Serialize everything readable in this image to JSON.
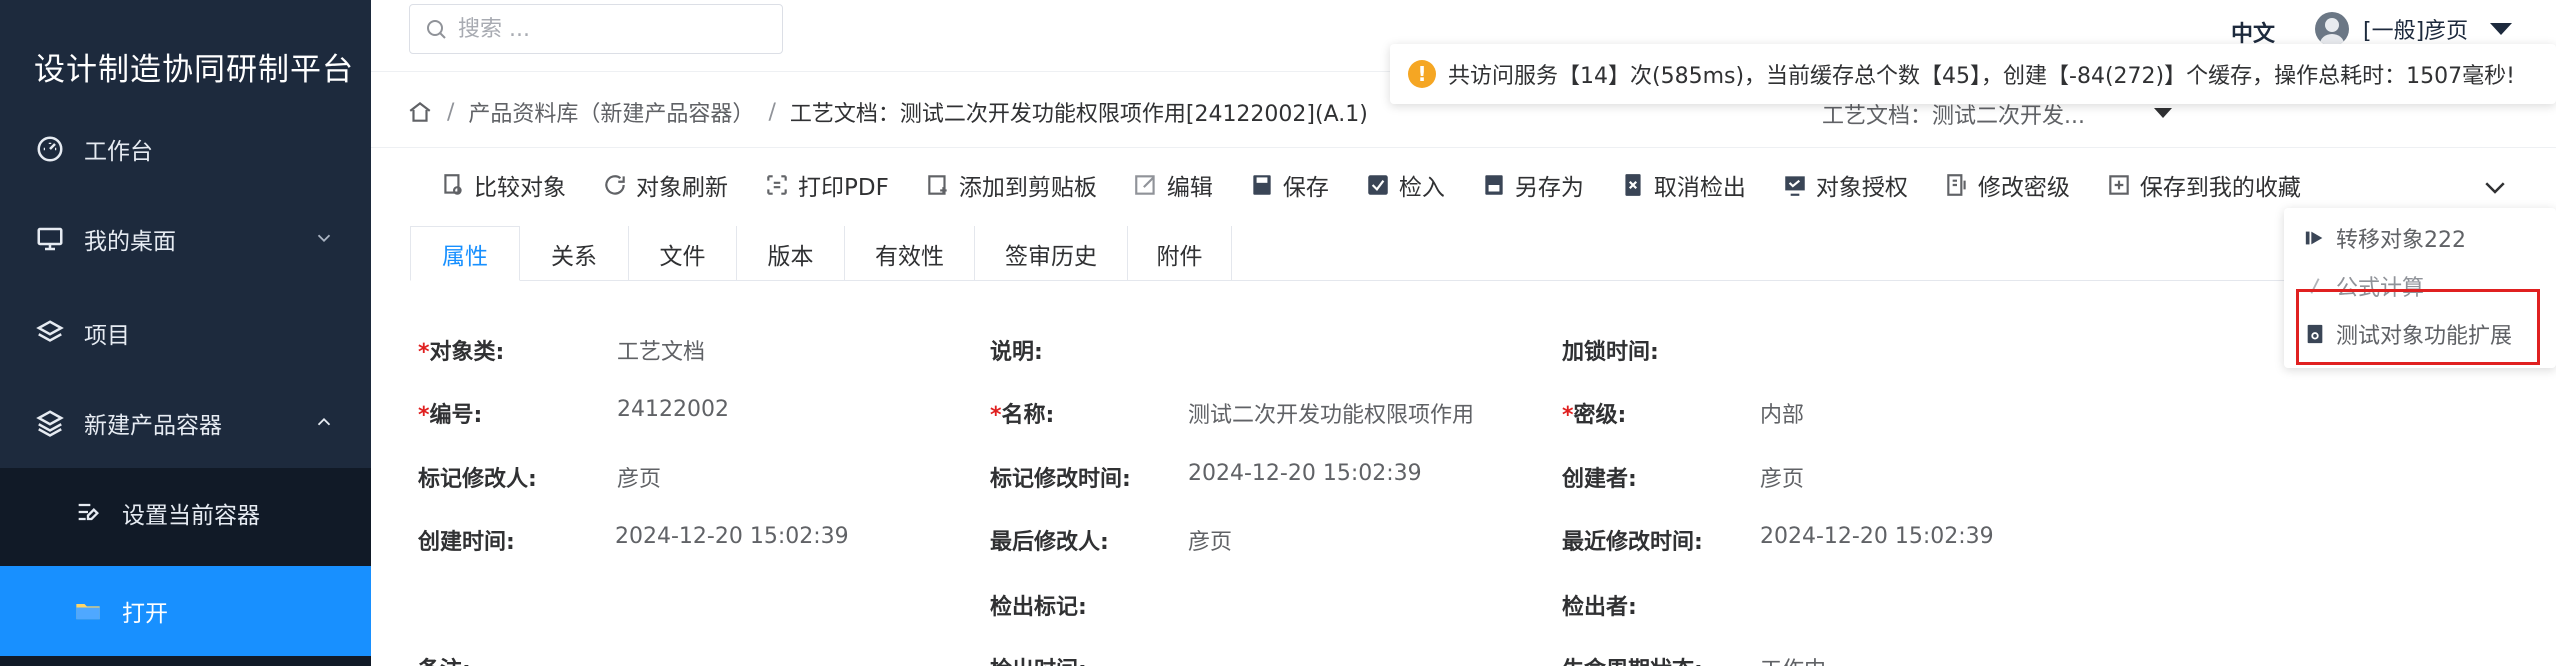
{
  "sidebar": {
    "brand": "设计制造协同研制平台",
    "items": [
      {
        "label": "工作台",
        "icon": "dashboard-icon"
      },
      {
        "label": "我的桌面",
        "icon": "monitor-icon"
      },
      {
        "label": "项目",
        "icon": "layers-icon"
      },
      {
        "label": "新建产品容器",
        "icon": "layers-icon"
      }
    ],
    "sub_items": [
      {
        "label": "设置当前容器",
        "icon": "list-settings-icon"
      },
      {
        "label": "打开",
        "icon": "folder-icon",
        "active": true
      }
    ],
    "bg_color": "#1d2a3d",
    "active_color": "#1890ff"
  },
  "header": {
    "search_placeholder": "搜索 ...",
    "language": "中文",
    "user": "[一般]彦页"
  },
  "notice": {
    "text": "共访问服务【14】次(585ms)，当前缓存总个数【45】，创建【-84(272)】个缓存，操作总耗时：1507毫秒!"
  },
  "breadcrumb": {
    "items": [
      "产品资料库（新建产品容器）",
      "工艺文档：测试二次开发功能权限项作用[24122002](A.1)"
    ],
    "select_value": "工艺文档：测试二次开发..."
  },
  "toolbar": {
    "buttons": [
      {
        "label": "比较对象",
        "icon": "compare-icon"
      },
      {
        "label": "对象刷新",
        "icon": "refresh-icon"
      },
      {
        "label": "打印PDF",
        "icon": "print-pdf-icon"
      },
      {
        "label": "添加到剪贴板",
        "icon": "clipboard-add-icon"
      },
      {
        "label": "编辑",
        "icon": "edit-icon"
      },
      {
        "label": "保存",
        "icon": "save-icon"
      },
      {
        "label": "检入",
        "icon": "checkin-icon"
      },
      {
        "label": "另存为",
        "icon": "save-as-icon"
      },
      {
        "label": "取消检出",
        "icon": "cancel-checkout-icon"
      },
      {
        "label": "对象授权",
        "icon": "authorize-icon"
      },
      {
        "label": "修改密级",
        "icon": "security-level-icon"
      },
      {
        "label": "保存到我的收藏",
        "icon": "favorite-add-icon"
      }
    ]
  },
  "tabs": [
    "属性",
    "关系",
    "文件",
    "版本",
    "有效性",
    "签审历史",
    "附件"
  ],
  "dropdown": {
    "items": [
      {
        "label": "转移对象222",
        "icon": "transfer-icon"
      },
      {
        "label": "公式计算",
        "icon": "formula-icon"
      },
      {
        "label": "测试对象功能扩展",
        "icon": "extension-icon"
      }
    ],
    "highlight_color": "#e02020"
  },
  "form": {
    "rows": [
      [
        {
          "label": "对象类:",
          "required": true,
          "value": "工艺文档"
        },
        {
          "label": "说明:",
          "required": false,
          "value": ""
        },
        {
          "label": "加锁时间:",
          "required": false,
          "value": ""
        }
      ],
      [
        {
          "label": "编号:",
          "required": true,
          "value": "24122002"
        },
        {
          "label": "名称:",
          "required": true,
          "value": "测试二次开发功能权限项作用"
        },
        {
          "label": "密级:",
          "required": true,
          "value": "内部"
        }
      ],
      [
        {
          "label": "标记修改人:",
          "required": false,
          "value": "彦页"
        },
        {
          "label": "标记修改时间:",
          "required": false,
          "value": "2024-12-20 15:02:39"
        },
        {
          "label": "创建者:",
          "required": false,
          "value": "彦页"
        }
      ],
      [
        {
          "label": "创建时间:",
          "required": false,
          "value": "2024-12-20 15:02:39"
        },
        {
          "label": "最后修改人:",
          "required": false,
          "value": "彦页"
        },
        {
          "label": "最近修改时间:",
          "required": false,
          "value": "2024-12-20 15:02:39"
        }
      ],
      [
        {
          "label": "",
          "required": false,
          "value": ""
        },
        {
          "label": "检出标记:",
          "required": false,
          "value": ""
        },
        {
          "label": "检出者:",
          "required": false,
          "value": ""
        }
      ],
      [
        {
          "label": "备注:",
          "required": false,
          "value": ""
        },
        {
          "label": "检出时间:",
          "required": false,
          "value": ""
        },
        {
          "label": "生命周期状态:",
          "required": false,
          "value": "工作中"
        }
      ]
    ]
  }
}
